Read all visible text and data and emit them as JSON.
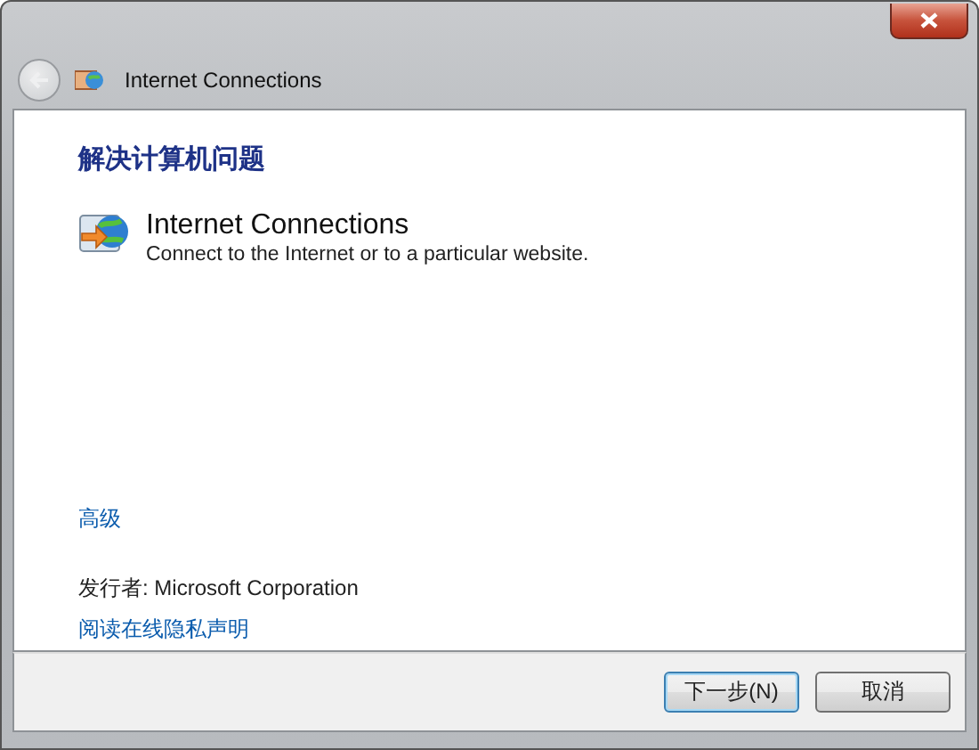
{
  "navigation": {
    "back_button": {
      "disabled": true
    },
    "title": "Internet Connections"
  },
  "heading": "解决计算机问题",
  "troubleshooter": {
    "title": "Internet Connections",
    "description": "Connect to the Internet or to a particular website."
  },
  "advanced_link": "高级",
  "publisher": {
    "label": "发行者:",
    "value": "Microsoft Corporation"
  },
  "privacy_link": "阅读在线隐私声明",
  "buttons": [
    {
      "label": "下一步(N)",
      "kind": "default"
    },
    {
      "label": "取消",
      "kind": "normal"
    }
  ]
}
